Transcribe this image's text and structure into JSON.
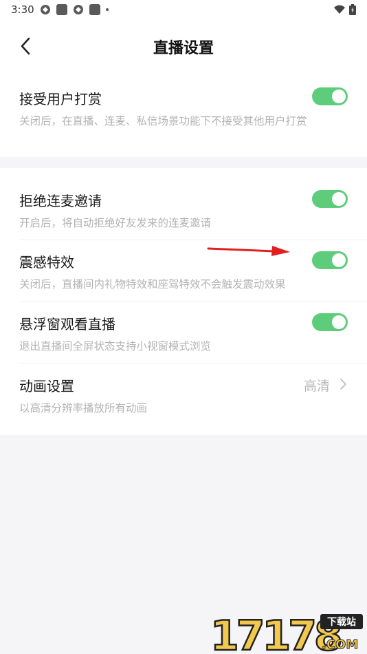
{
  "status_bar": {
    "time": "3:30"
  },
  "header": {
    "title": "直播设置"
  },
  "settings": {
    "accept_tips": {
      "title": "接受用户打赏",
      "description": "关闭后，在直播、连麦、私信场景功能下不接受其他用户打赏",
      "enabled": true
    },
    "reject_co_host": {
      "title": "拒绝连麦邀请",
      "description": "开启后，将自动拒绝好友发来的连麦邀请",
      "enabled": true
    },
    "haptic_effects": {
      "title": "震感特效",
      "description": "关闭后，直播间内礼物特效和座驾特效不会触发震动效果",
      "enabled": true
    },
    "floating_window": {
      "title": "悬浮窗观看直播",
      "description": "退出直播间全屏状态支持小视窗模式浏览",
      "enabled": true
    },
    "animation": {
      "title": "动画设置",
      "value": "高清",
      "description": "以高清分辨率播放所有动画"
    }
  },
  "colors": {
    "toggle_on": "#5dcd7c",
    "annotation_arrow": "#e02020"
  },
  "watermark": {
    "text": "17178",
    "badge": "下载站",
    "domain": ".COM"
  }
}
